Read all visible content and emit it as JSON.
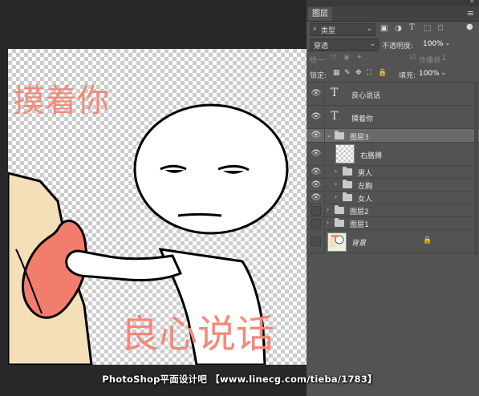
{
  "canvas": {
    "art_text_top": "摸着你",
    "art_text_bottom": "良心说话"
  },
  "panel": {
    "collapse_icon": "«",
    "tab_label": "图层",
    "menu_icon": "menu-icon",
    "filter_label": "类型",
    "blend_mode": "穿透",
    "opacity_label": "不透明度:",
    "opacity_value": "100%",
    "unify_label": "统一:",
    "propagate_label": "传播帧",
    "propagate_value": "1",
    "lock_label": "锁定:",
    "fill_label": "填充:",
    "fill_value": "100%"
  },
  "layers": [
    {
      "name": "良心说话",
      "kind": "text",
      "visible": true,
      "indent": 0
    },
    {
      "name": "摸着你",
      "kind": "text",
      "visible": true,
      "indent": 0
    },
    {
      "name": "图层3",
      "kind": "group-open",
      "visible": true,
      "indent": 0
    },
    {
      "name": "右胳膊",
      "kind": "pixel",
      "visible": true,
      "indent": 1
    },
    {
      "name": "男人",
      "kind": "group",
      "visible": true,
      "indent": 1
    },
    {
      "name": "左胸",
      "kind": "group",
      "visible": true,
      "indent": 1
    },
    {
      "name": "女人",
      "kind": "group",
      "visible": true,
      "indent": 1
    },
    {
      "name": "图层2",
      "kind": "group",
      "visible": false,
      "indent": 0
    },
    {
      "name": "图层1",
      "kind": "group",
      "visible": false,
      "indent": 0
    },
    {
      "name": "背景",
      "kind": "background",
      "visible": false,
      "indent": 0
    }
  ],
  "watermark": "PhotoShop平面设计吧 【www.linecg.com/tieba/1783】",
  "colors": {
    "art_text": "#f28a7a",
    "panel_bg": "#535353",
    "selected_row": "#6a6a6a"
  }
}
